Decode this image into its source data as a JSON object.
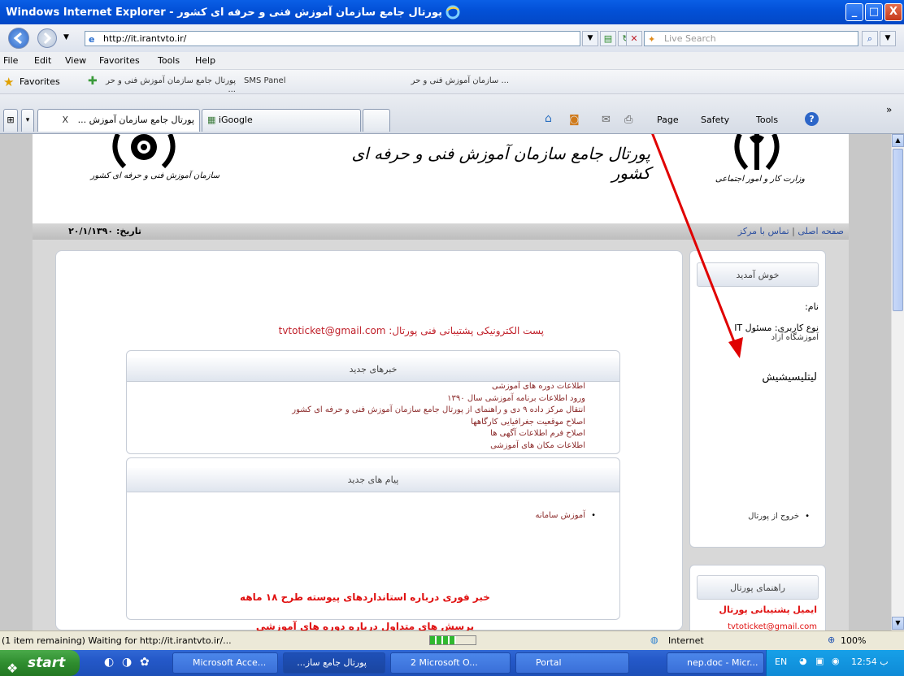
{
  "window": {
    "title": "پورتال جامع سازمان آموزش فنی و حرفه ای کشور - Windows Internet Explorer",
    "min": "_",
    "max": "□",
    "close": "X"
  },
  "address": {
    "url": "http://it.irantvto.ir/",
    "search_placeholder": "Live Search"
  },
  "menu": [
    "File",
    "Edit",
    "View",
    "Favorites",
    "Tools",
    "Help"
  ],
  "favorites": {
    "label": "Favorites",
    "links": [
      "پورتال جامع سازمان آموزش فنی و حر ...",
      "SMS Panel",
      "... سازمان آموزش فنی و حر"
    ]
  },
  "tabs": {
    "active": "پورتال جامع سازمان آموزش ...",
    "second": "iGoogle",
    "close": "X"
  },
  "commandbar": {
    "page": "Page",
    "safety": "Safety",
    "tools": "Tools",
    "help": "?"
  },
  "site": {
    "header_title": "پورتال جامع سازمان آموزش فنی و حرفه ای کشور",
    "logo_left_caption": "سازمان آموزش فنی و حرفه ای کشور",
    "logo_right_caption": "وزارت کار و امور اجتماعی",
    "date": "تاریخ: ۲۰/۱/۱۳۹۰",
    "nav_home": "صفحه اصلی",
    "nav_sep": "|",
    "nav_contact": "تماس با مرکز",
    "email_line": "پست الکترونیکی پشتیبانی فنی پورتال: tvtoticket@gmail.com",
    "news_title": "خبرهای جدید",
    "news_items": [
      "اطلاعات دوره های آموزشی",
      "ورود اطلاعات برنامه آموزشی سال ۱۳۹۰",
      "انتقال مرکز داده ۹ دی و راهنمای از پورتال جامع سازمان آموزش فنی و حرفه ای کشور",
      "اصلاح موقعیت جغرافیایی کارگاهها",
      "اصلاح فرم اطلاعات آگهی ها",
      "اطلاعات مکان های آموزشی"
    ],
    "messages_title": "پیام های جدید",
    "messages_items": [
      "آموزش سامانه"
    ],
    "red_link_1": "خبر فوری درباره استانداردهای پیوسته طرح ۱۸ ماهه",
    "red_link_2": "پرسش های متداول درباره دوره های آموزشی",
    "welcome_title": "خوش آمدید",
    "name_label": "نام:",
    "user_type": "نوع کاربری: مسئول IT",
    "user_org": "آموزشگاه آزاد",
    "typed_text": "لیتلیسیشیش",
    "logout": "خروج از پورتال",
    "guide_title": "راهنمای پورتال",
    "support_email_label": "ایمیل پشتیبانی پورتال",
    "support_email": "tvtoticket@gmail.com"
  },
  "status": {
    "text": "(1 item remaining) Waiting for http://it.irantvto.ir/...",
    "zone": "Internet",
    "zoom": "100%"
  },
  "taskbar": {
    "start": "start",
    "tasks": [
      "Microsoft Acce...",
      "پورتال جامع ساز...",
      "2 Microsoft O...",
      "Portal",
      "nep.doc - Micr..."
    ],
    "lang": "EN",
    "clock": "12:54 ب"
  },
  "colors": {
    "title_blue": "#0351d8",
    "red_text": "#c0202a",
    "link_blue": "#2c4fa0",
    "arrow_red": "#e00000"
  }
}
